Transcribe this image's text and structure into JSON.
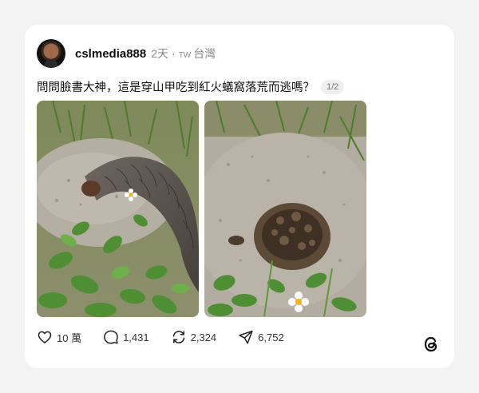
{
  "post": {
    "username": "cslmedia888",
    "time_ago": "2天",
    "separator": "·",
    "region_code": "TW",
    "region": "台灣",
    "text": "問問臉書大神，這是穿山甲吃到紅火蟻窩落荒而逃嗎？",
    "pager": "1/2"
  },
  "images": [
    {
      "alt": "pangolin-photo"
    },
    {
      "alt": "ant-nest-photo"
    }
  ],
  "actions": {
    "likes": "10 萬",
    "comments": "1,431",
    "reposts": "2,324",
    "shares": "6,752"
  },
  "icons": {
    "like": "heart-icon",
    "comment": "comment-bubble-icon",
    "repost": "repost-icon",
    "share": "send-icon",
    "brand": "threads-logo-icon"
  },
  "colors": {
    "background": "#f3f3f3",
    "card": "#ffffff",
    "text": "#101010",
    "muted": "#8a8a8a"
  }
}
